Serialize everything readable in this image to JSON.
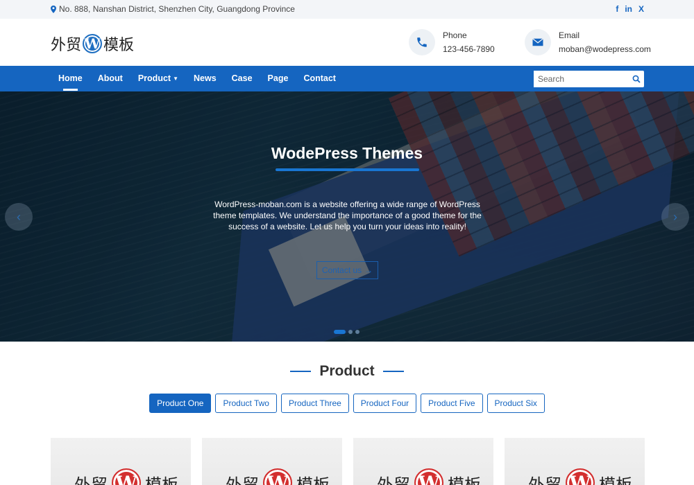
{
  "topbar": {
    "address": "No. 888, Nanshan District, Shenzhen City, Guangdong Province",
    "social": [
      "f",
      "in",
      "X"
    ]
  },
  "header": {
    "logo_left": "外贸",
    "logo_mark": "W",
    "logo_right": "模板",
    "phone_label": "Phone",
    "phone_value": "123-456-7890",
    "email_label": "Email",
    "email_value": "moban@wodepress.com"
  },
  "nav": {
    "items": [
      "Home",
      "About",
      "Product",
      "News",
      "Case",
      "Page",
      "Contact"
    ],
    "active": "Home",
    "search_placeholder": "Search"
  },
  "hero": {
    "title": "WodePress Themes",
    "text": "WordPress-moban.com is a website offering a wide range of WordPress theme templates. We understand the importance of a good theme for the success of a website. Let us help you turn your ideas into reality!",
    "cta": "Contact us",
    "prev": "‹",
    "next": "›"
  },
  "product": {
    "title": "Product",
    "tabs": [
      "Product One",
      "Product Two",
      "Product Three",
      "Product Four",
      "Product Five",
      "Product Six"
    ],
    "active_tab": "Product One",
    "card_logo_left": "外贸",
    "card_logo_mark": "W",
    "card_logo_right": "模板"
  },
  "colors": {
    "brand": "#1565c0",
    "topbar_bg": "#f3f5f8"
  }
}
